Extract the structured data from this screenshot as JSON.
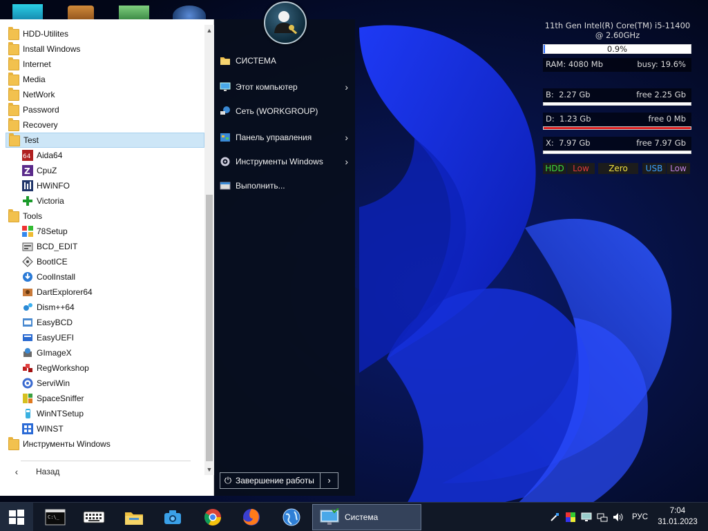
{
  "start_menu": {
    "programs": [
      {
        "label": "HDD-Utilites",
        "type": "folder"
      },
      {
        "label": "Install Windows",
        "type": "folder"
      },
      {
        "label": "Internet",
        "type": "folder"
      },
      {
        "label": "Media",
        "type": "folder"
      },
      {
        "label": "NetWork",
        "type": "folder"
      },
      {
        "label": "Password",
        "type": "folder"
      },
      {
        "label": "Recovery",
        "type": "folder"
      },
      {
        "label": "Test",
        "type": "folder",
        "selected": true
      },
      {
        "label": "Aida64",
        "type": "item",
        "icon": "aida64-icon"
      },
      {
        "label": "CpuZ",
        "type": "item",
        "icon": "cpuz-icon"
      },
      {
        "label": "HWiNFO",
        "type": "item",
        "icon": "hwinfo-icon"
      },
      {
        "label": "Victoria",
        "type": "item",
        "icon": "victoria-icon"
      },
      {
        "label": "Tools",
        "type": "folder"
      },
      {
        "label": "78Setup",
        "type": "item",
        "icon": "78setup-icon"
      },
      {
        "label": "BCD_EDIT",
        "type": "item",
        "icon": "bcd-edit-icon"
      },
      {
        "label": "BootICE",
        "type": "item",
        "icon": "bootice-icon"
      },
      {
        "label": "CoolInstall",
        "type": "item",
        "icon": "coolinstall-icon"
      },
      {
        "label": "DartExplorer64",
        "type": "item",
        "icon": "dartexplorer-icon"
      },
      {
        "label": "Dism++64",
        "type": "item",
        "icon": "dism-icon"
      },
      {
        "label": "EasyBCD",
        "type": "item",
        "icon": "easybcd-icon"
      },
      {
        "label": "EasyUEFI",
        "type": "item",
        "icon": "easyuefi-icon"
      },
      {
        "label": "GImageX",
        "type": "item",
        "icon": "gimagex-icon"
      },
      {
        "label": "RegWorkshop",
        "type": "item",
        "icon": "regworkshop-icon"
      },
      {
        "label": "ServiWin",
        "type": "item",
        "icon": "serviwin-icon"
      },
      {
        "label": "SpaceSniffer",
        "type": "item",
        "icon": "spacesniffer-icon"
      },
      {
        "label": "WinNTSetup",
        "type": "item",
        "icon": "winntsetup-icon"
      },
      {
        "label": "WINST",
        "type": "item",
        "icon": "winst-icon"
      },
      {
        "label": "Инструменты Windows",
        "type": "folder"
      }
    ],
    "back_label": "Назад",
    "right_links": [
      {
        "label": "СИСТЕМА",
        "icon": "folder-icon",
        "arrow": false
      },
      {
        "label": "Этот компьютер",
        "icon": "computer-icon",
        "arrow": true
      },
      {
        "label": "Сеть (WORKGROUP)",
        "icon": "network-icon",
        "arrow": false
      },
      {
        "label": "Панель управления",
        "icon": "control-panel-icon",
        "arrow": true
      },
      {
        "label": "Инструменты Windows",
        "icon": "tools-icon",
        "arrow": true
      },
      {
        "label": "Выполнить...",
        "icon": "run-icon",
        "arrow": false
      }
    ],
    "shutdown_label": "Завершение работы"
  },
  "sysmon": {
    "cpu_line1": "11th Gen Intel(R) Core(TM) i5-11400",
    "cpu_line2": "@ 2.60GHz",
    "cpu_load": "0.9%",
    "cpu_load_fraction": 0.009,
    "ram_label": "RAM: 4080 Mb",
    "ram_busy": "busy: 19.6%",
    "drives": [
      {
        "letter": "B:",
        "used": "2.27 Gb",
        "free": "free 2.25 Gb",
        "fill": 0.5,
        "fill_color": "#ffffff"
      },
      {
        "letter": "D:",
        "used": "1.23 Gb",
        "free": "free 0 Mb",
        "fill": 1.0,
        "fill_color": "#e02020"
      },
      {
        "letter": "X:",
        "used": "7.97 Gb",
        "free": "free 7.97 Gb",
        "fill": 0.0,
        "fill_color": "#ffffff"
      }
    ],
    "badges": [
      {
        "label": "HDD",
        "color": "#3ddc3d"
      },
      {
        "label": "Low",
        "color": "#e03a3a"
      },
      {
        "label": "Zero",
        "color": "#f0e040"
      },
      {
        "label": "USB",
        "color": "#3aa0ff"
      },
      {
        "label": "Low",
        "color": "#c080e0"
      }
    ]
  },
  "taskbar": {
    "app_label": "Система",
    "lang": "РУС",
    "time": "7:04",
    "date": "31.01.2023"
  },
  "colors": {
    "accent_selected": "#cde6f7",
    "taskbar_bg": "#111826"
  }
}
